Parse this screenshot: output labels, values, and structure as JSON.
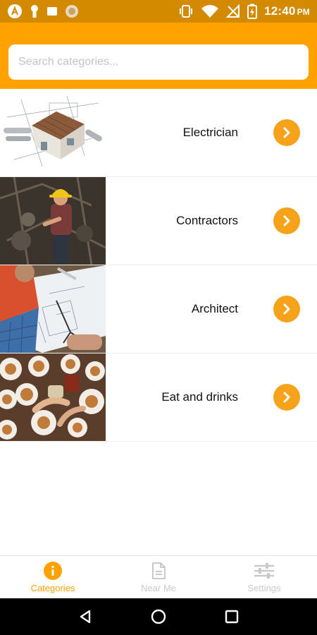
{
  "status_bar": {
    "time": "12:40",
    "ampm": "PM",
    "icons": [
      "app-icon",
      "keyhole-icon",
      "square-icon",
      "circle-icon",
      "vibrate-icon",
      "wifi-icon",
      "no-signal-icon",
      "battery-charging-icon"
    ]
  },
  "search": {
    "placeholder": "Search categories..."
  },
  "categories": [
    {
      "label": "Electrician",
      "image": "house-blueprint"
    },
    {
      "label": "Contractors",
      "image": "construction-worker"
    },
    {
      "label": "Architect",
      "image": "architect-drawing"
    },
    {
      "label": "Eat and drinks",
      "image": "food-table"
    }
  ],
  "bottom_nav": {
    "items": [
      {
        "label": "Categories",
        "icon": "info-circle-icon",
        "active": true
      },
      {
        "label": "Near Me",
        "icon": "document-icon",
        "active": false
      },
      {
        "label": "Settings",
        "icon": "sliders-icon",
        "active": false
      }
    ]
  },
  "colors": {
    "status_bar": "#d48a00",
    "header": "#ffa200",
    "accent_button": "#f7a21b",
    "inactive_nav": "#c9c9c9"
  }
}
